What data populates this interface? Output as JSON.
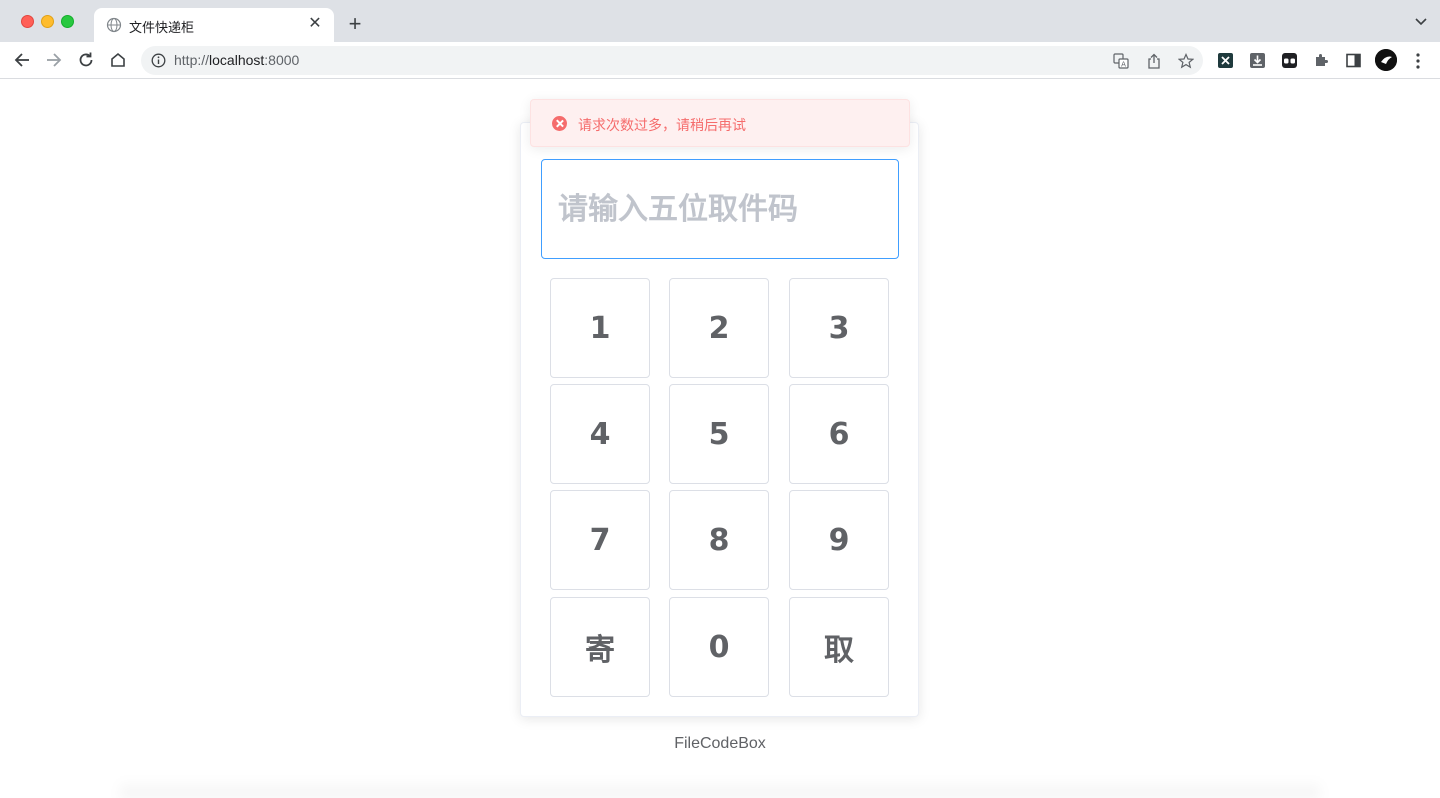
{
  "browser": {
    "tab_title": "文件快递柜",
    "url_scheme": "http://",
    "url_host": "localhost",
    "url_port": ":8000",
    "new_tab_symbol": "+",
    "close_symbol": "✕"
  },
  "alert": {
    "type": "error",
    "message": "请求次数过多，请稍后再试",
    "color": "#f56c6c"
  },
  "code_input": {
    "placeholder": "请输入五位取件码",
    "value": ""
  },
  "keypad": {
    "keys": [
      "1",
      "2",
      "3",
      "4",
      "5",
      "6",
      "7",
      "8",
      "9",
      "寄",
      "0",
      "取"
    ]
  },
  "footer": {
    "brand": "FileCodeBox"
  },
  "colors": {
    "accent": "#409eff",
    "error": "#f56c6c",
    "error_bg": "#fef0f0"
  }
}
